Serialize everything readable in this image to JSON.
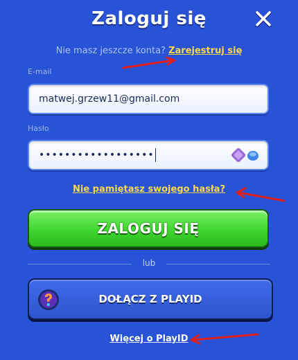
{
  "header": {
    "title": "Zaloguj się",
    "close_icon": "close-icon"
  },
  "register": {
    "prompt": "Nie masz jeszcze konta?",
    "link": "Zarejestruj się"
  },
  "form": {
    "email_label": "E-mail",
    "email_value": "matwej.grzew11@gmail.com",
    "password_label": "Hasło",
    "password_masked": "••••••••••••••••••",
    "password_icon": "password-manager-icon"
  },
  "forgot_link": "Nie pamiętasz swojego hasła?",
  "login_button": "ZALOGUJ SIĘ",
  "divider_text": "lub",
  "playid_button": {
    "label": "DOŁĄCZ Z PLAYID",
    "icon": "playid-logo-icon"
  },
  "more_link": "Więcej o PlayID",
  "colors": {
    "background": "#2853d6",
    "link_yellow": "#ffd84a",
    "login_green": "#3fd62f",
    "annotation_arrow": "#e0201c"
  }
}
